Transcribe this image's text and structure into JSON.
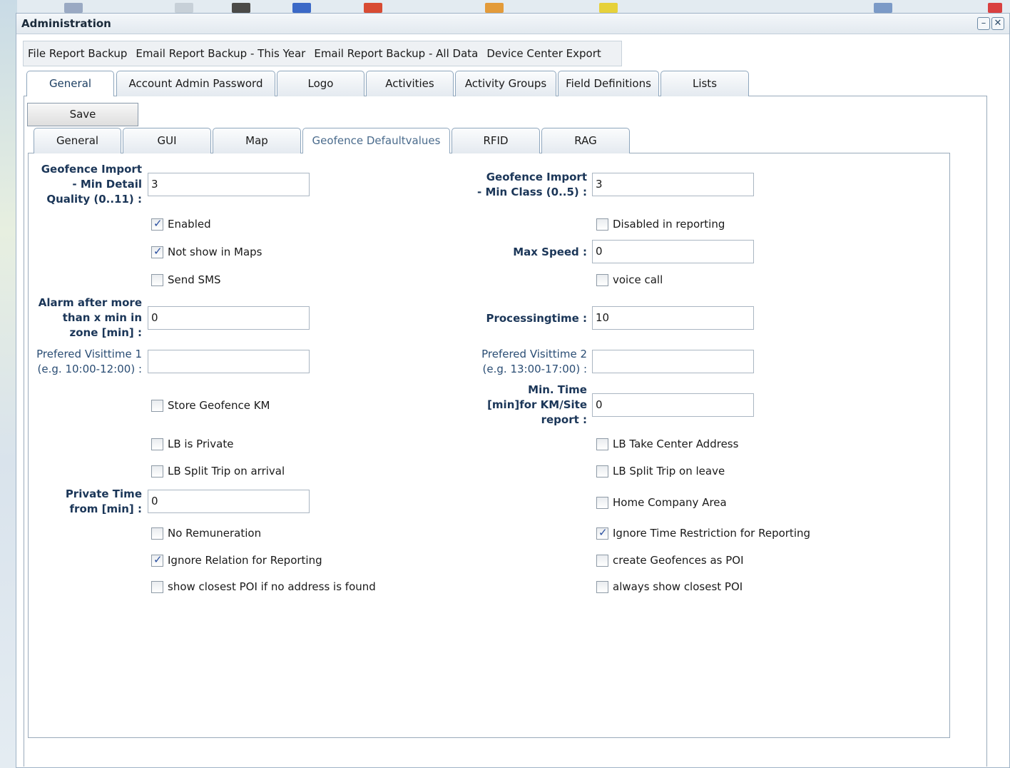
{
  "window": {
    "title": "Administration",
    "minimize_icon": "minimize-icon",
    "close_icon": "close-icon"
  },
  "toolbar": [
    "File Report Backup",
    "Email Report Backup - This Year",
    "Email Report Backup - All Data",
    "Device Center Export"
  ],
  "main_tabs": [
    "General",
    "Account Admin Password",
    "Logo",
    "Activities",
    "Activity Groups",
    "Field Definitions",
    "Lists"
  ],
  "save_label": "Save",
  "sub_tabs": [
    "General",
    "GUI",
    "Map",
    "Geofence Defaultvalues",
    "RFID",
    "RAG"
  ],
  "form": {
    "min_detail_quality": {
      "label_1": "Geofence Import",
      "label_2": "- Min Detail",
      "label_3": "Quality (0..11) :",
      "value": "3"
    },
    "min_class": {
      "label_1": "Geofence Import",
      "label_2": "- Min Class (0..5) :",
      "value": "3"
    },
    "enabled": {
      "label": "Enabled",
      "checked": true
    },
    "disabled_in_reporting": {
      "label": "Disabled in reporting",
      "checked": false
    },
    "not_show_in_maps": {
      "label": "Not show in Maps",
      "checked": true
    },
    "max_speed": {
      "label": "Max Speed :",
      "value": "0"
    },
    "send_sms": {
      "label": "Send SMS",
      "checked": false
    },
    "voice_call": {
      "label": "voice call",
      "checked": false
    },
    "alarm_after": {
      "label_1": "Alarm after more",
      "label_2": "than x min in",
      "label_3": "zone [min] :",
      "value": "0"
    },
    "processingtime": {
      "label": "Processingtime :",
      "value": "10"
    },
    "visittime_1": {
      "label_1": "Prefered Visittime 1",
      "label_2": "(e.g. 10:00-12:00) :",
      "value": ""
    },
    "visittime_2": {
      "label_1": "Prefered Visittime 2",
      "label_2": "(e.g. 13:00-17:00) :",
      "value": ""
    },
    "store_geofence_km": {
      "label": "Store Geofence KM",
      "checked": false
    },
    "min_time": {
      "label_1": "Min. Time",
      "label_2": "[min]for KM/Site",
      "label_3": "report :",
      "value": "0"
    },
    "lb_is_private": {
      "label": "LB is Private",
      "checked": false
    },
    "lb_take_center": {
      "label": "LB Take Center Address",
      "checked": false
    },
    "lb_split_arrival": {
      "label": "LB Split Trip on arrival",
      "checked": false
    },
    "lb_split_leave": {
      "label": "LB Split Trip on leave",
      "checked": false
    },
    "private_time": {
      "label_1": "Private Time",
      "label_2": "from [min] :",
      "value": "0"
    },
    "home_company_area": {
      "label": "Home Company Area",
      "checked": false
    },
    "no_remuneration": {
      "label": "No Remuneration",
      "checked": false
    },
    "ignore_time_restriction": {
      "label": "Ignore Time Restriction for Reporting",
      "checked": true
    },
    "ignore_relation": {
      "label": "Ignore Relation for Reporting",
      "checked": true
    },
    "create_geofences_poi": {
      "label": "create Geofences as POI",
      "checked": false
    },
    "show_closest_poi": {
      "label": "show closest POI if no address is found",
      "checked": false
    },
    "always_show_closest_poi": {
      "label": "always show closest POI",
      "checked": false
    }
  }
}
